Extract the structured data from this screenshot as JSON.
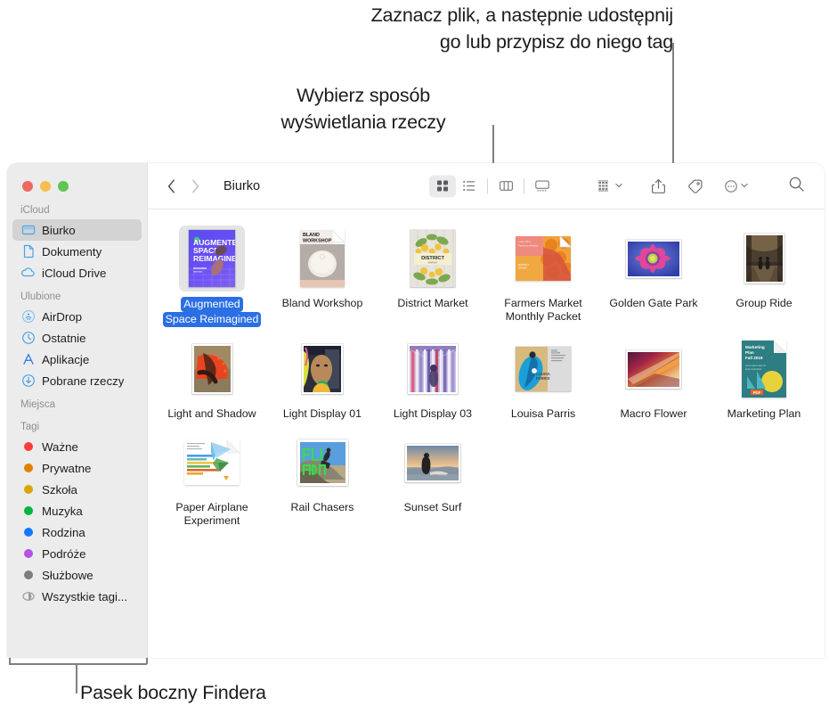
{
  "callouts": {
    "share_tag": "Zaznacz plik, a następnie udostępnij\ngo lub przypisz do niego tag",
    "view_mode": "Wybierz sposób\nwyświetlania rzeczy",
    "sidebar": "Pasek boczny Findera"
  },
  "window": {
    "traffic_lights": [
      "close",
      "minimize",
      "zoom"
    ],
    "colors": {
      "close": "#ec6a5f",
      "minimize": "#f5bf4f",
      "zoom": "#61c454",
      "sidebar_bg": "#ececec",
      "selection_blue": "#2b6fe3",
      "sidebar_selected_bg": "#d3d3d3",
      "icon_blue": "#4aa3e8"
    }
  },
  "toolbar": {
    "back_label": "Wstecz",
    "forward_label": "Dalej",
    "title": "Biurko",
    "view_modes": [
      {
        "name": "icon-view",
        "label": "Widok ikon",
        "active": true
      },
      {
        "name": "list-view",
        "label": "Widok listy",
        "active": false
      },
      {
        "name": "column-view",
        "label": "Widok kolumn",
        "active": false
      },
      {
        "name": "gallery-view",
        "label": "Widok galerii",
        "active": false
      }
    ],
    "group_label": "Grupuj",
    "share_label": "Udostępnij",
    "tag_label": "Tagi",
    "more_label": "Więcej",
    "search_label": "Szukaj"
  },
  "sidebar": {
    "sections": [
      {
        "title": "iCloud",
        "items": [
          {
            "label": "Biurko",
            "icon": "desktop-icon",
            "selected": true
          },
          {
            "label": "Dokumenty",
            "icon": "document-icon",
            "selected": false
          },
          {
            "label": "iCloud Drive",
            "icon": "cloud-icon",
            "selected": false
          }
        ]
      },
      {
        "title": "Ulubione",
        "items": [
          {
            "label": "AirDrop",
            "icon": "airdrop-icon",
            "selected": false
          },
          {
            "label": "Ostatnie",
            "icon": "clock-icon",
            "selected": false
          },
          {
            "label": "Aplikacje",
            "icon": "applications-icon",
            "selected": false
          },
          {
            "label": "Pobrane rzeczy",
            "icon": "downloads-icon",
            "selected": false
          }
        ]
      },
      {
        "title": "Miejsca",
        "items": []
      },
      {
        "title": "Tagi",
        "items": [
          {
            "label": "Ważne",
            "icon": "tag-dot",
            "color": "#fc3d39"
          },
          {
            "label": "Prywatne",
            "icon": "tag-dot",
            "color": "#e08100"
          },
          {
            "label": "Szkoła",
            "icon": "tag-dot",
            "color": "#dba500"
          },
          {
            "label": "Muzyka",
            "icon": "tag-dot",
            "color": "#00b43d"
          },
          {
            "label": "Rodzina",
            "icon": "tag-dot",
            "color": "#1478ff"
          },
          {
            "label": "Podróże",
            "icon": "tag-dot",
            "color": "#b council"
          },
          {
            "label": "Służbowe",
            "icon": "tag-dot",
            "color": "#7c7c80"
          },
          {
            "label": "Wszystkie tagi...",
            "icon": "all-tags-icon",
            "color": ""
          }
        ]
      }
    ]
  },
  "files": [
    {
      "name": "Augmented\nSpace Reimagined",
      "kind": "image",
      "selected": true,
      "thumb": "augmented-space"
    },
    {
      "name": "Bland Workshop",
      "kind": "document",
      "selected": false,
      "thumb": "bland-workshop"
    },
    {
      "name": "District Market",
      "kind": "image",
      "selected": false,
      "thumb": "district-market"
    },
    {
      "name": "Farmers Market\nMonthly Packet",
      "kind": "document",
      "selected": false,
      "thumb": "farmers-market"
    },
    {
      "name": "Golden Gate Park",
      "kind": "image",
      "selected": false,
      "thumb": "golden-gate"
    },
    {
      "name": "Group Ride",
      "kind": "image",
      "selected": false,
      "thumb": "group-ride"
    },
    {
      "name": "Light and Shadow",
      "kind": "image",
      "selected": false,
      "thumb": "light-shadow"
    },
    {
      "name": "Light Display 01",
      "kind": "image",
      "selected": false,
      "thumb": "light-display-01"
    },
    {
      "name": "Light Display 03",
      "kind": "image",
      "selected": false,
      "thumb": "light-display-03"
    },
    {
      "name": "Louisa Parris",
      "kind": "image",
      "selected": false,
      "thumb": "louisa-parris"
    },
    {
      "name": "Macro Flower",
      "kind": "image",
      "selected": false,
      "thumb": "macro-flower"
    },
    {
      "name": "Marketing Plan",
      "kind": "document",
      "selected": false,
      "thumb": "marketing-plan"
    },
    {
      "name": "Paper Airplane\nExperiment",
      "kind": "document",
      "selected": false,
      "thumb": "paper-airplane"
    },
    {
      "name": "Rail Chasers",
      "kind": "image",
      "selected": false,
      "thumb": "rail-chasers"
    },
    {
      "name": "Sunset Surf",
      "kind": "image",
      "selected": false,
      "thumb": "sunset-surf"
    }
  ]
}
